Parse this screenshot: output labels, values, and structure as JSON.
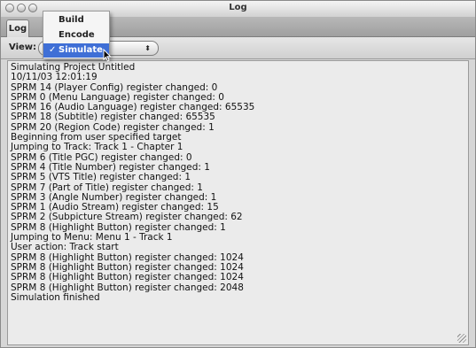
{
  "window": {
    "title": "Log"
  },
  "tabs": [
    {
      "label": "Log"
    }
  ],
  "toolbar": {
    "view_label": "View:",
    "view_selected": "Simulate"
  },
  "menu": {
    "items": [
      {
        "label": "Build",
        "checked": false
      },
      {
        "label": "Encode",
        "checked": false
      },
      {
        "label": "Simulate",
        "checked": true,
        "check_glyph": "✓"
      }
    ]
  },
  "log": {
    "lines": [
      "Simulating Project Untitled",
      "10/11/03 12:01:19",
      "SPRM 14 (Player Config) register changed: 0",
      "SPRM 0 (Menu Language) register changed: 0",
      "SPRM 16 (Audio Language) register changed: 65535",
      "SPRM 18 (Subtitle) register changed: 65535",
      "SPRM 20 (Region Code) register changed: 1",
      "Beginning from user specified target",
      "Jumping to Track: Track 1 - Chapter 1",
      "SPRM 6 (Title PGC) register changed: 0",
      "SPRM 4 (Title Number) register changed: 1",
      "SPRM 5 (VTS Title) register changed: 1",
      "SPRM 7 (Part of Title) register changed: 1",
      "SPRM 3 (Angle Number) register changed: 1",
      "SPRM 1 (Audio Stream) register changed: 15",
      "SPRM 2 (Subpicture Stream) register changed: 62",
      "SPRM 8 (Highlight Button) register changed: 1",
      "Jumping to Menu: Menu 1 - Track 1",
      "User action: Track start",
      "SPRM 8 (Highlight Button) register changed: 1024",
      "SPRM 8 (Highlight Button) register changed: 1024",
      "SPRM 8 (Highlight Button) register changed: 1024",
      "SPRM 8 (Highlight Button) register changed: 2048",
      "Simulation finished"
    ]
  },
  "colors": {
    "menu_highlight": "#3f6fd6",
    "log_background": "#ebebeb"
  }
}
